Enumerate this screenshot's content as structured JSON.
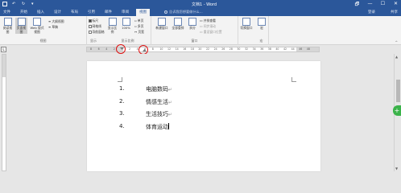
{
  "titlebar": {
    "title": "文档1 - Word",
    "window_controls": [
      "🗗",
      "—",
      "☐",
      "✕"
    ]
  },
  "tabs": [
    {
      "label": "文件",
      "active": false
    },
    {
      "label": "开始",
      "active": false
    },
    {
      "label": "插入",
      "active": false
    },
    {
      "label": "设计",
      "active": false
    },
    {
      "label": "布局",
      "active": false
    },
    {
      "label": "引用",
      "active": false
    },
    {
      "label": "邮件",
      "active": false
    },
    {
      "label": "审阅",
      "active": false
    },
    {
      "label": "视图",
      "active": true
    }
  ],
  "tell_me": "告诉我您想要做什么...",
  "signin": "登录",
  "share": "共享",
  "ribbon": {
    "views": {
      "label": "视图",
      "buttons": [
        "阅读视图",
        "页面视图",
        "Web 版式视图"
      ],
      "small": [
        "大纲视图",
        "草稿"
      ]
    },
    "show": {
      "label": "显示",
      "items": [
        {
          "label": "标尺",
          "checked": true
        },
        {
          "label": "网格线",
          "checked": false
        },
        {
          "label": "导航窗格",
          "checked": false
        }
      ]
    },
    "zoom": {
      "label": "显示比例",
      "buttons": [
        "显示比例",
        "100%"
      ],
      "small": [
        "单页",
        "多页",
        "页宽"
      ]
    },
    "window": {
      "label": "窗口",
      "buttons": [
        "新建窗口",
        "全部重排",
        "拆分"
      ],
      "small": [
        "并排查看",
        "同步滚动",
        "重设窗口位置"
      ],
      "switch": "切换窗口"
    },
    "macros": {
      "label": "宏",
      "button": "宏"
    }
  },
  "ruler": {
    "corner": "L",
    "numbers": [
      "8",
      "6",
      "4",
      "2",
      "",
      "2",
      "4",
      "6",
      "8",
      "10",
      "12",
      "14",
      "16",
      "18",
      "20",
      "22",
      "24",
      "26",
      "28",
      "30",
      "32",
      "34",
      "36",
      "38",
      "40",
      "42",
      "44",
      "46",
      "48"
    ]
  },
  "document": {
    "list": [
      {
        "num": "1.",
        "text": "电脑数码",
        "mark": "↵"
      },
      {
        "num": "2.",
        "text": "情感生活",
        "mark": "↵"
      },
      {
        "num": "3.",
        "text": "生活技巧",
        "mark": "↵"
      },
      {
        "num": "4.",
        "text": "体育运动",
        "mark": ""
      }
    ]
  },
  "colors": {
    "accent": "#2b579a",
    "ribbon_bg": "#f3f3f3",
    "highlight_ring": "#dd1111",
    "fab": "#3bb34a"
  }
}
